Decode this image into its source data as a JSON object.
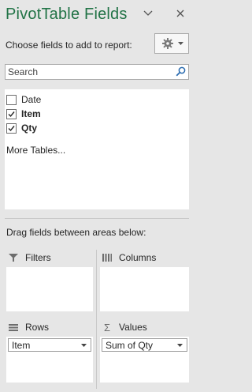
{
  "panel": {
    "title": "PivotTable Fields",
    "choose_label": "Choose fields to add to report:",
    "drag_label": "Drag fields between areas below:"
  },
  "search": {
    "placeholder": "Search"
  },
  "fields": [
    {
      "label": "Date",
      "checked": false,
      "bold": false
    },
    {
      "label": "Item",
      "checked": true,
      "bold": true
    },
    {
      "label": "Qty",
      "checked": true,
      "bold": true
    }
  ],
  "more_tables": "More Tables...",
  "areas": {
    "filters": {
      "label": "Filters",
      "items": []
    },
    "columns": {
      "label": "Columns",
      "items": []
    },
    "rows": {
      "label": "Rows",
      "items": [
        "Item"
      ]
    },
    "values": {
      "label": "Values",
      "items": [
        "Sum of Qty"
      ]
    }
  },
  "colors": {
    "title_green": "#217346",
    "panel_bg": "#e6e6e6",
    "box_bg": "#ffffff",
    "border": "#ababab"
  },
  "icons": {
    "collapse": "chevron-down-icon",
    "close": "close-icon",
    "tools": "gear-icon",
    "search": "search-icon",
    "filters": "filter-icon",
    "columns": "columns-icon",
    "rows": "rows-icon",
    "values": "sigma-icon"
  }
}
